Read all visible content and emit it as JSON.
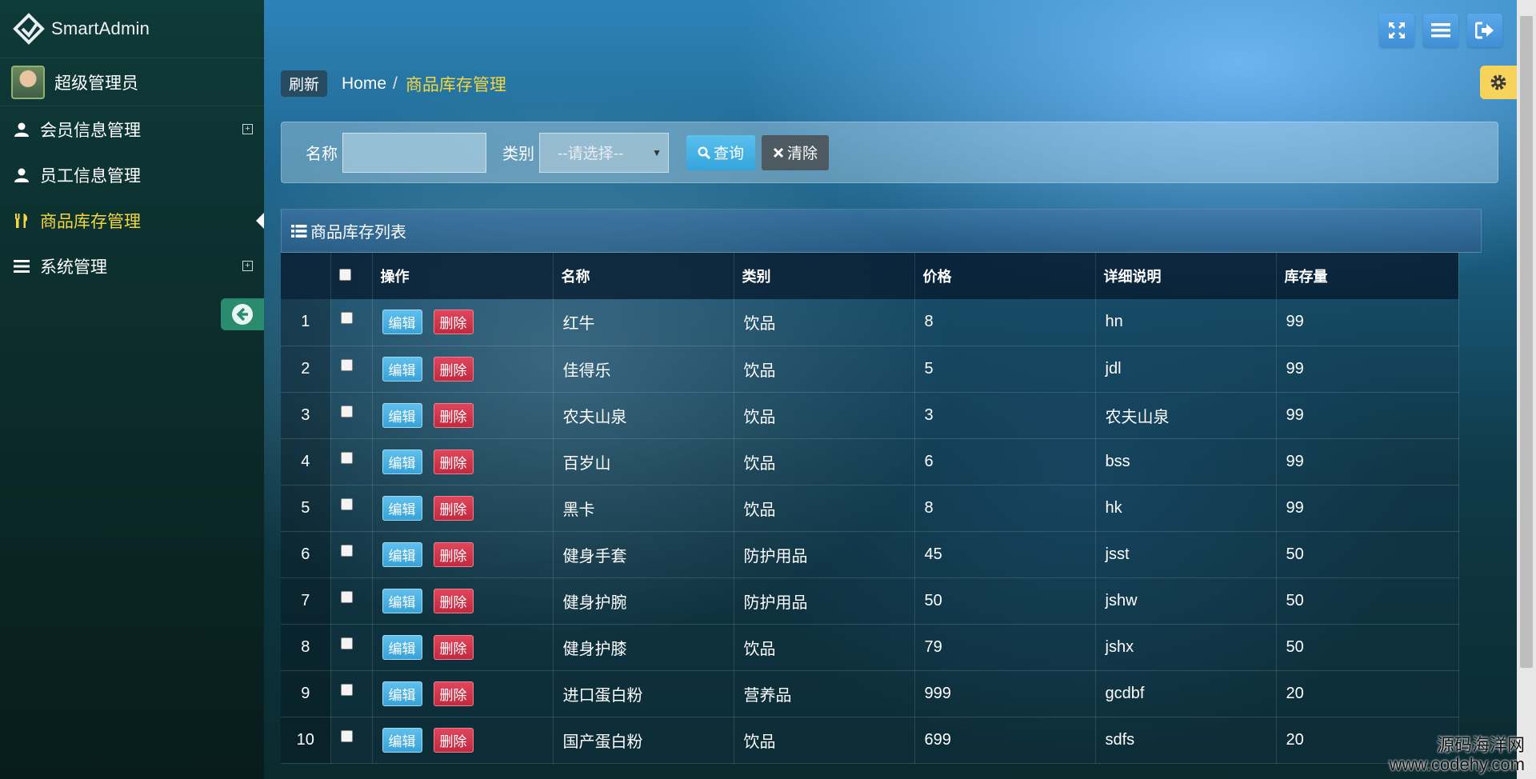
{
  "app": {
    "logo_text": "SmartAdmin",
    "user_name": "超级管理员"
  },
  "colors": {
    "accent_yellow": "#f5d63f",
    "edit_blue": "#38a2d8",
    "delete_red": "#c12a3f",
    "sidebar_bg": "#0b2b2a"
  },
  "sidebar": {
    "items": [
      {
        "label": "会员信息管理",
        "icon": "user-icon",
        "expandable": true,
        "active": false
      },
      {
        "label": "员工信息管理",
        "icon": "user-icon",
        "expandable": false,
        "active": false
      },
      {
        "label": "商品库存管理",
        "icon": "cutlery-icon",
        "expandable": false,
        "active": true
      },
      {
        "label": "系统管理",
        "icon": "list-icon",
        "expandable": true,
        "active": false
      }
    ]
  },
  "breadcrumb": {
    "refresh_label": "刷新",
    "home": "Home",
    "separator": "/",
    "current": "商品库存管理"
  },
  "search": {
    "name_label": "名称",
    "name_value": "",
    "type_label": "类别",
    "type_selected": "--请选择--",
    "search_button": "查询",
    "clear_button": "清除"
  },
  "list": {
    "title": "商品库存列表",
    "columns": [
      "操作",
      "名称",
      "类别",
      "价格",
      "详细说明",
      "库存量"
    ],
    "edit_label": "编辑",
    "delete_label": "删除",
    "rows": [
      {
        "no": "1",
        "name": "红牛",
        "type": "饮品",
        "price": "8",
        "desc": "hn",
        "stock": "99"
      },
      {
        "no": "2",
        "name": "佳得乐",
        "type": "饮品",
        "price": "5",
        "desc": "jdl",
        "stock": "99"
      },
      {
        "no": "3",
        "name": "农夫山泉",
        "type": "饮品",
        "price": "3",
        "desc": "农夫山泉",
        "stock": "99"
      },
      {
        "no": "4",
        "name": "百岁山",
        "type": "饮品",
        "price": "6",
        "desc": "bss",
        "stock": "99"
      },
      {
        "no": "5",
        "name": "黑卡",
        "type": "饮品",
        "price": "8",
        "desc": "hk",
        "stock": "99"
      },
      {
        "no": "6",
        "name": "健身手套",
        "type": "防护用品",
        "price": "45",
        "desc": "jsst",
        "stock": "50"
      },
      {
        "no": "7",
        "name": "健身护腕",
        "type": "防护用品",
        "price": "50",
        "desc": "jshw",
        "stock": "50"
      },
      {
        "no": "8",
        "name": "健身护膝",
        "type": "饮品",
        "price": "79",
        "desc": "jshx",
        "stock": "50"
      },
      {
        "no": "9",
        "name": "进口蛋白粉",
        "type": "营养品",
        "price": "999",
        "desc": "gcdbf",
        "stock": "20"
      },
      {
        "no": "10",
        "name": "国产蛋白粉",
        "type": "饮品",
        "price": "699",
        "desc": "sdfs",
        "stock": "20"
      }
    ]
  },
  "watermark": {
    "line1": "源码海洋网",
    "line2": "www.codehy.com"
  }
}
